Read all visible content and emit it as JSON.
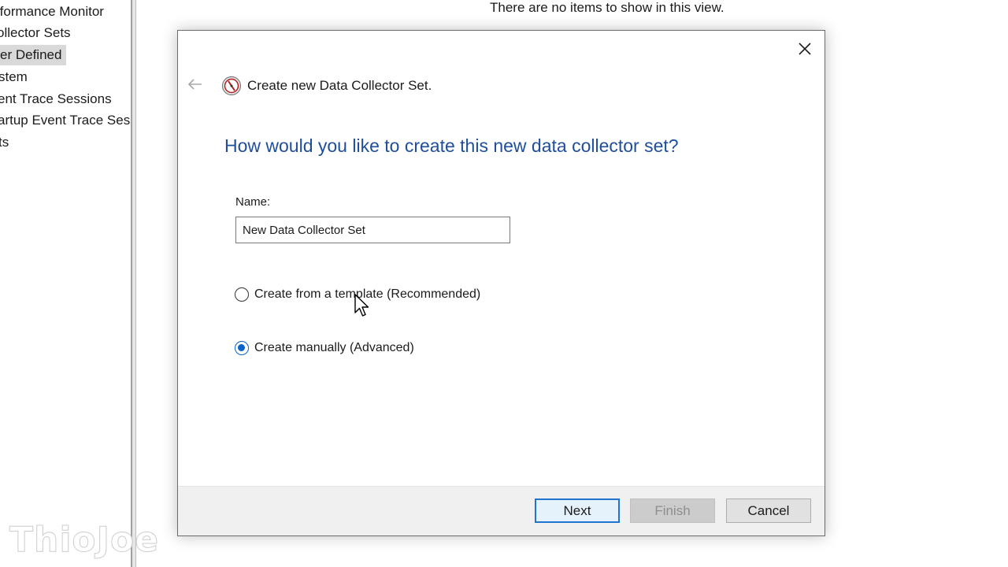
{
  "tree": {
    "items": [
      {
        "label": "rformance Monitor",
        "selected": false
      },
      {
        "label": "ollector Sets",
        "selected": false
      },
      {
        "label": "er Defined",
        "selected": true
      },
      {
        "label": "stem",
        "selected": false
      },
      {
        "label": "ent Trace Sessions",
        "selected": false
      },
      {
        "label": "artup Event Trace Ses",
        "selected": false
      },
      {
        "label": "ts",
        "selected": false
      }
    ]
  },
  "main": {
    "empty_message": "There are no items to show in this view."
  },
  "dialog": {
    "title": "Create new Data Collector Set.",
    "question": "How would you like to create this new data collector set?",
    "name_label": "Name:",
    "name_value": "New Data Collector Set",
    "options": [
      {
        "label": "Create from a template (Recommended)",
        "checked": false
      },
      {
        "label": "Create manually (Advanced)",
        "checked": true
      }
    ],
    "buttons": {
      "next": "Next",
      "finish": "Finish",
      "cancel": "Cancel"
    }
  },
  "watermark": "ThioJoe",
  "colors": {
    "heading_blue": "#1e4e9c",
    "accent_blue": "#0a64c8",
    "footer_bg": "#f0f0f0"
  }
}
